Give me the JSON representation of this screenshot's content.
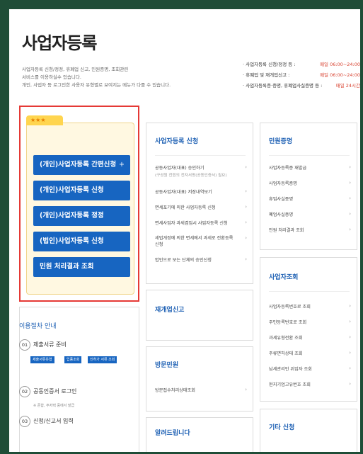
{
  "page": {
    "title": "사업자등록",
    "desc": [
      "사업자등록 신청/정정, 휴폐업 신고, 민원증명, 조회관련",
      "서비스를 이용하실수 있습니다.",
      "개인, 사업자 등 로그인한 사용자 유형별로 보여지는 메뉴가 다를 수 있습니다."
    ]
  },
  "hours": [
    {
      "label": "· 사업자등록 신청/정정 등 :",
      "value": "매일 06:00~24:00"
    },
    {
      "label": "· 휴폐업 및 재개업신고 :",
      "value": "매일 06:00~24:00"
    },
    {
      "label": "· 사업자등록증·증명, 휴폐업사실증명 등 :",
      "value": "매일 24시간"
    }
  ],
  "quick": {
    "stars": "★★★",
    "buttons": [
      {
        "label": "(개인)사업자등록 간편신청",
        "extra": "+"
      },
      {
        "label": "(개인)사업자등록 신청"
      },
      {
        "label": "(개인)사업자등록 정정"
      },
      {
        "label": "(법인)사업자등록 신청"
      },
      {
        "label": "민원 처리결과 조회"
      }
    ]
  },
  "register": {
    "title": "사업자등록 신청",
    "items": [
      {
        "label": "공동사업자(대표) 승인하기",
        "sub": "(구성원 전원의 전자서명(공동인증서) 필요)"
      },
      {
        "label": "공동사업자(대표) 저장내역보기"
      },
      {
        "label": "면세포기에 의한 사업자등록 신청"
      },
      {
        "label": "면세사업자 과세겸업시 사업자등록 신청"
      },
      {
        "label": "세법개정에 의한 면세에서 과세로 전환등록 신청"
      },
      {
        "label": "법인으로 보는 단체의 승인신청"
      }
    ]
  },
  "reopen": {
    "title": "재개업신고"
  },
  "visit": {
    "title": "방문민원",
    "items": [
      {
        "label": "방문접수처리상태조회"
      }
    ]
  },
  "notice": {
    "title": "알려드립니다"
  },
  "certs": {
    "title": "민원증명",
    "items": [
      {
        "label": "사업자등록증 재발급"
      },
      {
        "label": "사업자등록증명"
      },
      {
        "label": "휴업사실증명"
      },
      {
        "label": "폐업사실증명"
      },
      {
        "label": "민원 처리결과 조회"
      }
    ]
  },
  "lookup": {
    "title": "사업자조회",
    "items": [
      {
        "label": "사업자등록번호로 조회"
      },
      {
        "label": "주민등록번호로 조회"
      },
      {
        "label": "과세유형전환 조회"
      },
      {
        "label": "주류면허상태 조회"
      },
      {
        "label": "납세관리인 위임자 조회"
      },
      {
        "label": "현지기업고유번호 조회"
      }
    ]
  },
  "other": {
    "title": "기타 신청"
  },
  "process": {
    "title": "이용절차 안내",
    "steps": [
      {
        "num": "01",
        "label": "제출서류 준비"
      },
      {
        "num": "02",
        "label": "공동인증서 로그인"
      },
      {
        "num": "03",
        "label": "신청/신고서 입력"
      }
    ],
    "tags": [
      "제출서류유형",
      "업종조회",
      "인허가 서류 조회"
    ],
    "hint": "※ 존함, 주저택 중에서 발급"
  },
  "chevron": "›"
}
